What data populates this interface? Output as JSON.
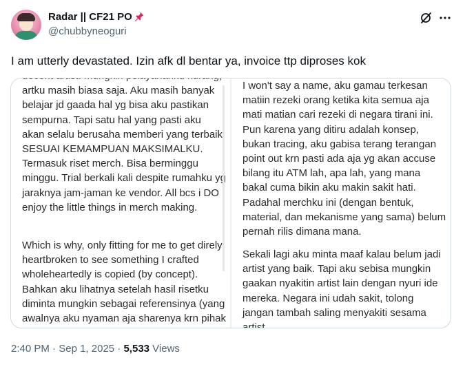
{
  "author": {
    "display_name": "Radar || CF21 PO",
    "handle": "@chubbyneoguri"
  },
  "icons": {
    "pin": "pushpin-icon",
    "grok": "grok-icon",
    "more": "more-icon"
  },
  "tweet": {
    "text": "I am utterly devastated. Izin afk dl bentar ya, invoice ttp diproses kok"
  },
  "media": {
    "left_page": {
      "paragraph_1": "decent artist. Mungkin pelayananku kurang, artku masih biasa saja. Aku masih banyak belajar jd gaada hal yg bisa aku pastikan sempurna. Tapi satu hal yang pasti aku akan selalu berusaha memberi yang terbaik SESUAI KEMAMPUAN MAKSIMALKU. Termasuk riset merch. Bisa berminggu minggu. Trial berkali kali despite rumahku yg jaraknya jam-jaman ke vendor. All bcs i DO enjoy the little things in merch making.",
      "paragraph_2": "Which is why, only fitting for me to get direly heartbroken to see something I crafted wholeheartedly is copied (by concept). Bahkan aku lihatnya setelah hasil risetku diminta mungkin sebagai referensinya (yang awalnya aku nyaman aja sharenya krn pihak ini udah aku"
    },
    "right_page": {
      "paragraph_1": "I won't say a name, aku gamau terkesan matiin rezeki orang ketika kita semua aja mati matian cari rezeki di negara tirani ini. Pun karena yang ditiru adalah konsep, bukan tracing, aku gabisa terang terangan point out krn pasti ada aja yg akan accuse bilang itu ATM lah, apa lah, yang mana bakal cuma bikin aku makin sakit hati. Padahal merchku ini (dengan bentuk, material, dan mekanisme yang sama) belum pernah rilis dimana mana.",
      "paragraph_2": "Sekali lagi aku minta maaf kalau belum jadi artist yang baik. Tapi aku sebisa mungkin gaakan nyakitin artist lain dengan nyuri ide mereka. Negara ini udah sakit, tolong jangan tambah saling menyakiti sesama artist."
    }
  },
  "meta": {
    "time": "2:40 PM",
    "separator": " · ",
    "date": "Sep 1, 2025",
    "views_count": "5,533",
    "views_label": " Views"
  },
  "colors": {
    "text": "#0f1419",
    "secondary": "#536471",
    "border": "#cfd9de",
    "pin": "#e0245e"
  }
}
